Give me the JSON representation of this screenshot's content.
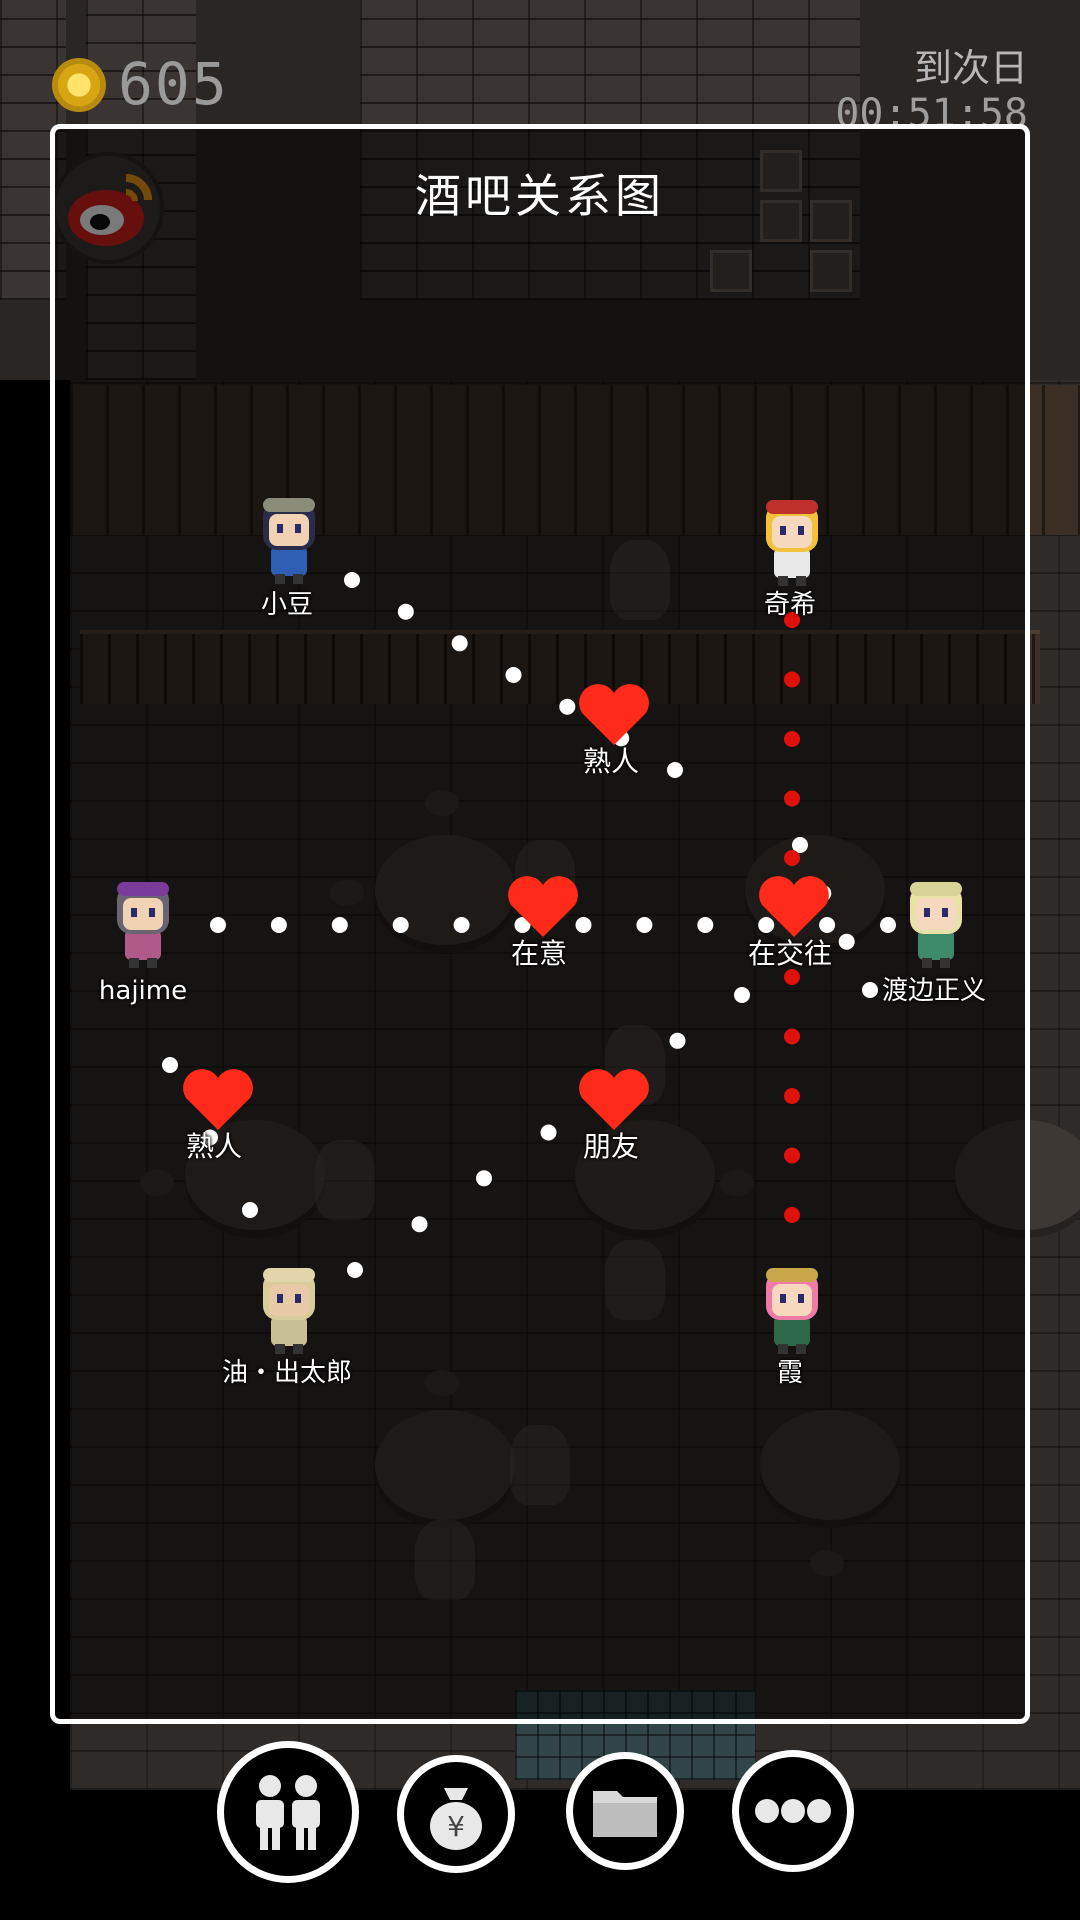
{
  "hud": {
    "coins": "605",
    "next_day_label": "到次日",
    "next_day_timer": "00:51:58"
  },
  "panel": {
    "title": "酒吧关系图"
  },
  "characters": [
    {
      "name": "小豆",
      "hair": "#2b2b4a",
      "cap": "#8c8c7a",
      "cloth": "#2f5fb5",
      "skin": "#f1d2b3"
    },
    {
      "name": "奇希",
      "hair": "#f2c23a",
      "cap": "#c0302a",
      "cloth": "#e8e8e8",
      "skin": "#f5d8bd"
    },
    {
      "name": "hajime",
      "hair": "#6a6470",
      "cap": "#7a3c9a",
      "cloth": "#b05a8a",
      "skin": "#f1d2b3"
    },
    {
      "name": "渡边正义",
      "hair": "#e8e2a8",
      "cap": "#d9d39a",
      "cloth": "#3e8a6a",
      "skin": "#f5d8bd"
    },
    {
      "name": "油・出太郎",
      "hair": "#d8cc9a",
      "cap": "#e0d6aa",
      "cloth": "#c8bf95",
      "skin": "#e8c9a8"
    },
    {
      "name": "霞",
      "hair": "#f07aa8",
      "cap": "#caa64a",
      "cloth": "#2e6a4a",
      "skin": "#f5d8bd"
    }
  ],
  "relations": [
    {
      "label": "熟人",
      "color": "white"
    },
    {
      "label": "在意",
      "color": "white"
    },
    {
      "label": "在交往",
      "color": "white"
    },
    {
      "label": "熟人",
      "color": "white"
    },
    {
      "label": "朋友",
      "color": "white"
    },
    {
      "label": "",
      "color": "red"
    }
  ],
  "toolbar": {
    "buttons": [
      {
        "name": "people-icon"
      },
      {
        "name": "money-bag-icon"
      },
      {
        "name": "folder-icon"
      },
      {
        "name": "more-icon"
      }
    ]
  },
  "colors": {
    "heart": "#ff2a1a",
    "red_dot": "#e0100a",
    "white_dot": "#ffffff",
    "panel_border": "#ffffff"
  }
}
